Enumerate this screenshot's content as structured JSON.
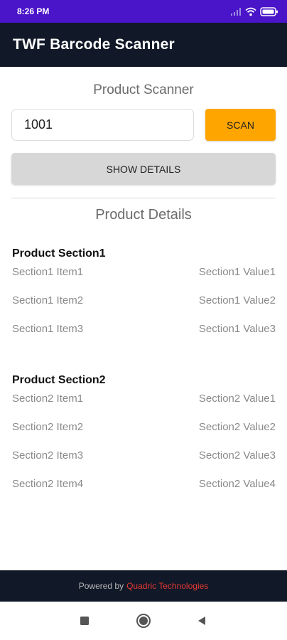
{
  "status_bar": {
    "time": "8:26 PM",
    "icons": [
      "signal-icon",
      "wifi-icon",
      "battery-icon"
    ]
  },
  "app_bar": {
    "title": "TWF Barcode Scanner"
  },
  "scanner": {
    "title": "Product Scanner",
    "input_value": "1001",
    "scan_label": "SCAN",
    "details_label": "SHOW DETAILS"
  },
  "details": {
    "title": "Product Details",
    "sections": [
      {
        "title": "Product Section1",
        "rows": [
          {
            "item": "Section1 Item1",
            "value": "Section1 Value1"
          },
          {
            "item": "Section1 Item2",
            "value": "Section1 Value2"
          },
          {
            "item": "Section1 Item3",
            "value": "Section1 Value3"
          }
        ]
      },
      {
        "title": "Product Section2",
        "rows": [
          {
            "item": "Section2 Item1",
            "value": "Section2 Value1"
          },
          {
            "item": "Section2 Item2",
            "value": "Section2 Value2"
          },
          {
            "item": "Section2 Item3",
            "value": "Section2 Value3"
          },
          {
            "item": "Section2 Item4",
            "value": "Section2 Value4"
          }
        ]
      }
    ]
  },
  "footer": {
    "prefix": "Powered by",
    "brand": "Quadric Technologies"
  },
  "nav_bar": {
    "buttons": [
      "recents-icon",
      "home-icon",
      "back-icon"
    ]
  },
  "colors": {
    "status_bar": "#4a14c8",
    "app_bar": "#111827",
    "scan_button": "#ffa500",
    "details_button": "#d7d7d7",
    "footer_brand": "#e53935"
  }
}
